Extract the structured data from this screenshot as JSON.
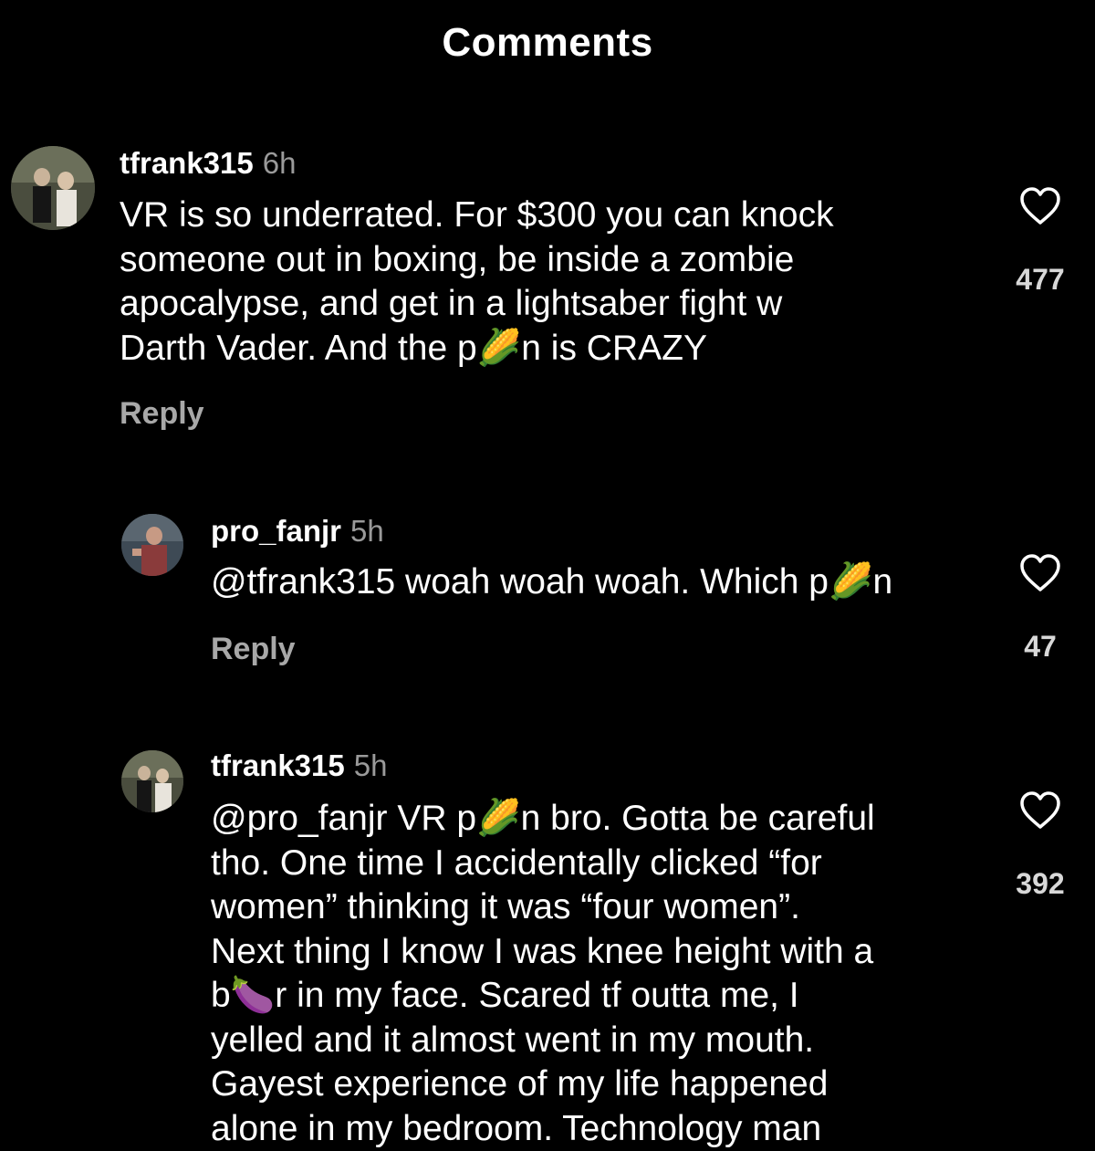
{
  "header": {
    "title": "Comments"
  },
  "icons": {
    "like": "heart-icon",
    "avatar": "avatar-photo"
  },
  "comments": [
    {
      "username": "tfrank315",
      "time": "6h",
      "text": "VR is so underrated. For $300 you can knock\nsomeone out in boxing, be inside a zombie\napocalypse, and get in a lightsaber fight w\nDarth Vader. And the p🌽n is CRAZY",
      "reply_label": "Reply",
      "likes": "477"
    },
    {
      "username": "pro_fanjr",
      "time": "5h",
      "text": "@tfrank315 woah woah woah. Which p🌽n",
      "reply_label": "Reply",
      "likes": "47"
    },
    {
      "username": "tfrank315",
      "time": "5h",
      "text": "@pro_fanjr VR p🌽n bro. Gotta be careful\ntho. One time I accidentally clicked “for\nwomen” thinking it was “four women”.\nNext thing I know I was knee height with a\nb🍆r in my face. Scared tf outta me, I\nyelled and it almost went in my mouth.\nGayest experience of my life happened\nalone in my bedroom. Technology man",
      "likes": "392"
    }
  ]
}
